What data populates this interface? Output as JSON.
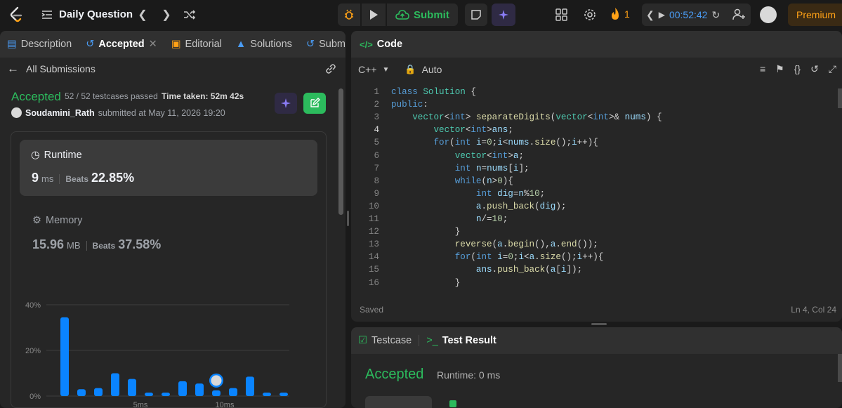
{
  "topbar": {
    "title": "Daily Question",
    "submit_label": "Submit",
    "streak": "1",
    "timer": "00:52:42",
    "premium_label": "Premium"
  },
  "left": {
    "tabs": [
      {
        "label": "Description"
      },
      {
        "label": "Accepted"
      },
      {
        "label": "Editorial"
      },
      {
        "label": "Solutions"
      },
      {
        "label": "Subm"
      }
    ],
    "back_label": "All Submissions",
    "status": "Accepted",
    "testcases": "52 / 52 testcases passed",
    "time_taken": "Time taken: 52m 42s",
    "user": "Soudamini_Rath",
    "submitted_at": "submitted at May 11, 2026 19:20",
    "runtime": {
      "label": "Runtime",
      "value": "9",
      "unit": "ms",
      "beats_label": "Beats",
      "beats": "22.85%"
    },
    "memory": {
      "label": "Memory",
      "value": "15.96",
      "unit": "MB",
      "beats_label": "Beats",
      "beats": "37.58%"
    }
  },
  "chart_data": {
    "type": "bar",
    "ytick_labels": [
      "40%",
      "20%",
      "0%"
    ],
    "xtick_labels": [
      "5ms",
      "10ms"
    ],
    "ylim": [
      0,
      40
    ],
    "values": [
      34.5,
      3,
      3.5,
      10,
      7.5,
      1.5,
      1.5,
      6.5,
      5.5,
      2.5,
      3.5,
      8.5,
      1.5,
      1.5
    ],
    "marker_index": 9,
    "bar_color": "#0a84ff",
    "grid": true
  },
  "editor": {
    "tab_label": "Code",
    "language": "C++",
    "mode": "Auto",
    "status": "Saved",
    "cursor": "Ln 4, Col 24",
    "lines": [
      "class Solution {",
      "public:",
      "    vector<int> separateDigits(vector<int>& nums) {",
      "        vector<int>ans;",
      "        for(int i=0;i<nums.size();i++){",
      "            vector<int>a;",
      "            int n=nums[i];",
      "            while(n>0){",
      "                int dig=n%10;",
      "                a.push_back(dig);",
      "                n/=10;",
      "            }",
      "            reverse(a.begin(),a.end());",
      "            for(int i=0;i<a.size();i++){",
      "                ans.push_back(a[i]);",
      "            }"
    ]
  },
  "result": {
    "testcase_label": "Testcase",
    "result_label": "Test Result",
    "status": "Accepted",
    "runtime": "Runtime: 0 ms"
  },
  "colors": {
    "accent_green": "#2cbb5d",
    "accent_orange": "#ffa116",
    "accent_blue": "#4a9cf5"
  }
}
